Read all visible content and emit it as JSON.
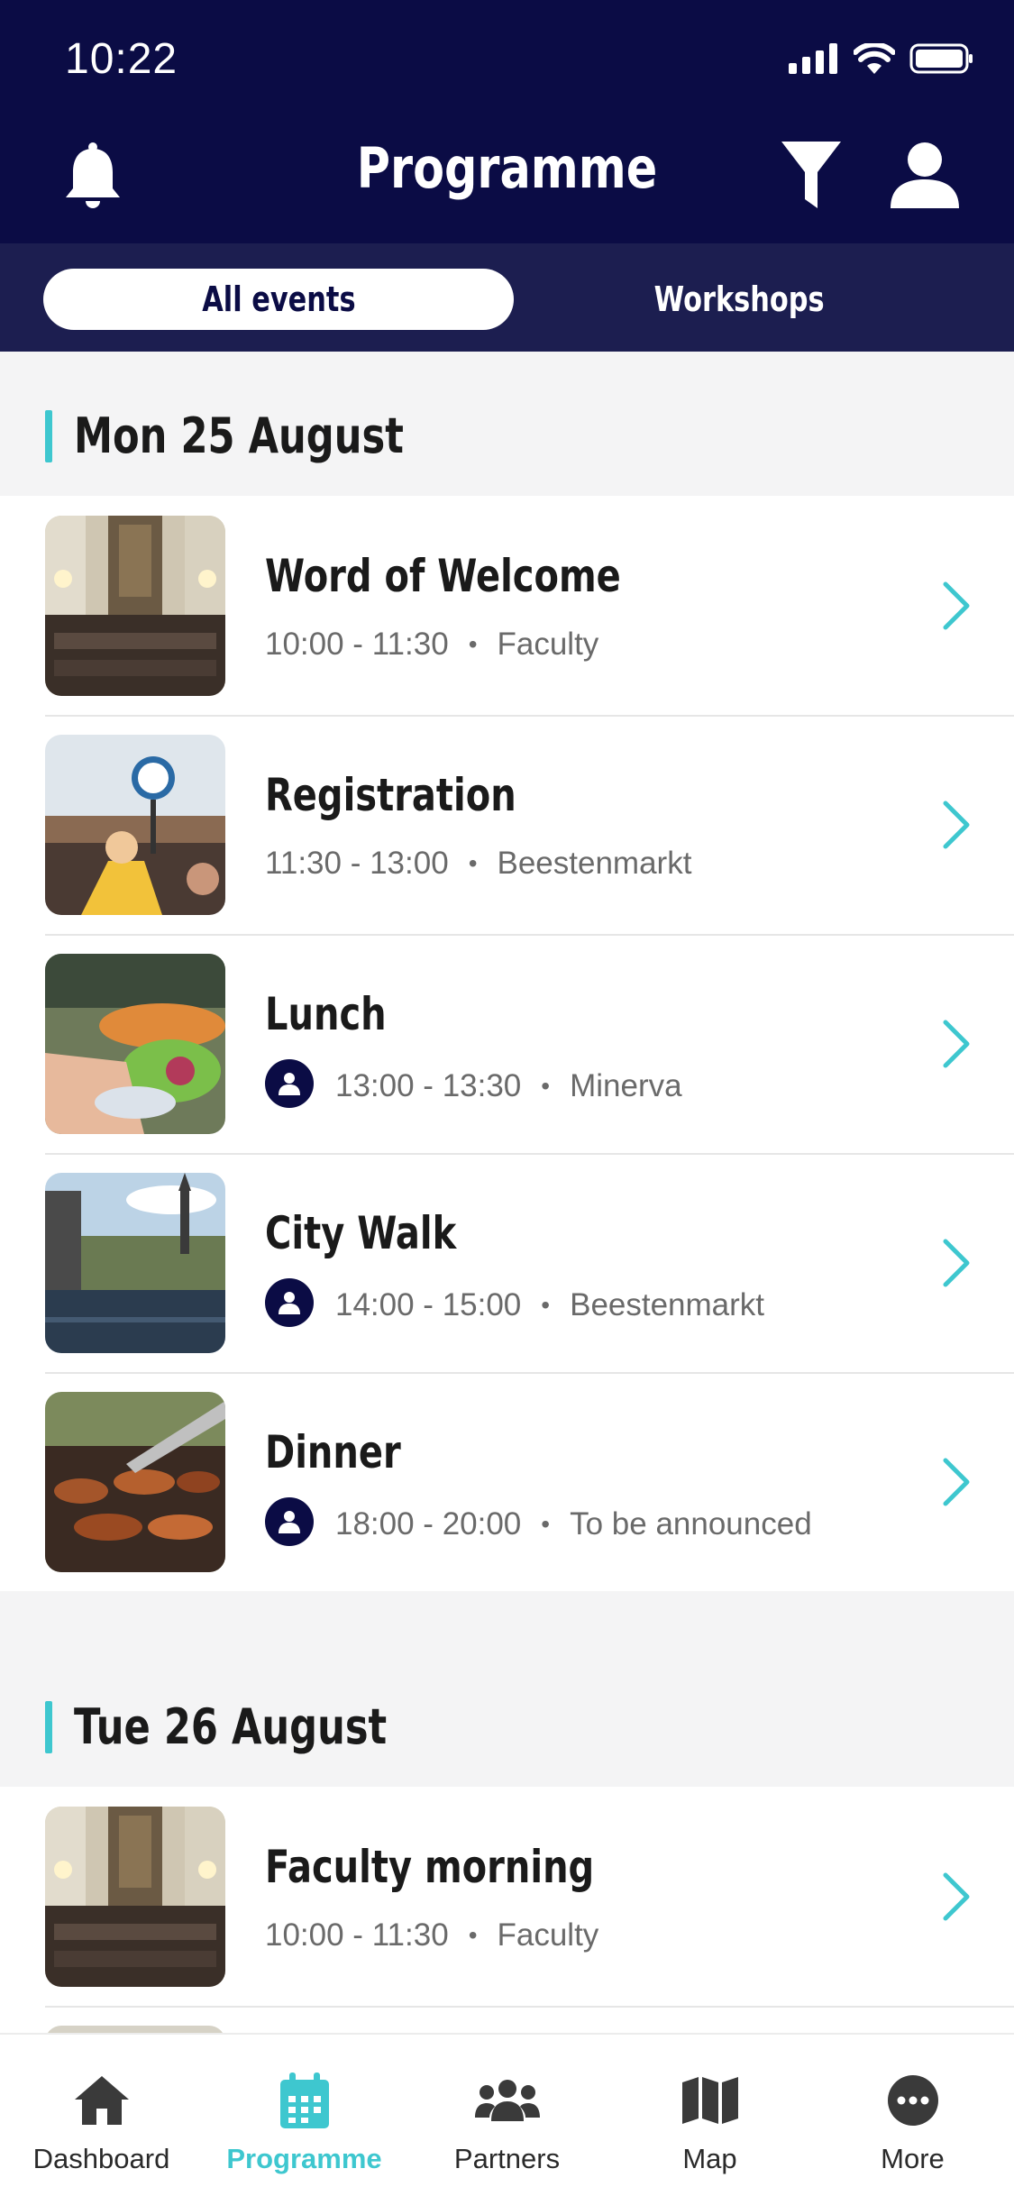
{
  "status_bar": {
    "time": "10:22"
  },
  "header": {
    "title": "Programme"
  },
  "tabs": [
    {
      "label": "All events",
      "active": true
    },
    {
      "label": "Workshops",
      "active": false
    }
  ],
  "days": [
    {
      "title": "Mon 25 August",
      "events": [
        {
          "title": "Word of Welcome",
          "time": "10:00 - 11:30",
          "location": "Faculty",
          "has_person_icon": false,
          "image": "church-hall"
        },
        {
          "title": "Registration",
          "time": "11:30 - 13:00",
          "location": "Beestenmarkt",
          "has_person_icon": false,
          "image": "crowd-sign"
        },
        {
          "title": "Lunch",
          "time": "13:00 - 13:30",
          "location": "Minerva",
          "has_person_icon": true,
          "image": "salad-table"
        },
        {
          "title": "City Walk",
          "time": "14:00 - 15:00",
          "location": "Beestenmarkt",
          "has_person_icon": true,
          "image": "canal"
        },
        {
          "title": "Dinner",
          "time": "18:00 - 20:00",
          "location": "To be announced",
          "has_person_icon": true,
          "image": "barbecue"
        }
      ]
    },
    {
      "title": "Tue 26 August",
      "events": [
        {
          "title": "Faculty morning",
          "time": "10:00 - 11:30",
          "location": "Faculty",
          "has_person_icon": false,
          "image": "church-hall"
        }
      ]
    }
  ],
  "bottom_nav": [
    {
      "label": "Dashboard",
      "icon": "home-icon",
      "active": false
    },
    {
      "label": "Programme",
      "icon": "calendar-icon",
      "active": true
    },
    {
      "label": "Partners",
      "icon": "people-icon",
      "active": false
    },
    {
      "label": "Map",
      "icon": "map-icon",
      "active": false
    },
    {
      "label": "More",
      "icon": "more-icon",
      "active": false
    }
  ],
  "colors": {
    "header": "#0b0c45",
    "tabbar": "#1c1e50",
    "accent": "#3ec7cf"
  }
}
